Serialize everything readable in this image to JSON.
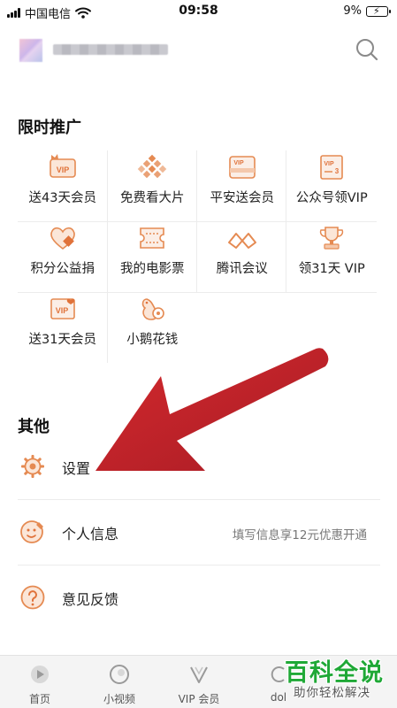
{
  "status_bar": {
    "carrier": "中国电信",
    "time": "09:58",
    "battery": "9%"
  },
  "header": {
    "username": "",
    "search_icon": "search-icon"
  },
  "promo": {
    "title": "限时推广",
    "items": [
      {
        "label": "送43天会员",
        "icon": "vip-badge-icon"
      },
      {
        "label": "免费看大片",
        "icon": "mosaic-icon"
      },
      {
        "label": "平安送会员",
        "icon": "vip-card-icon"
      },
      {
        "label": "公众号领VIP",
        "icon": "vip-3-icon"
      },
      {
        "label": "积分公益捐",
        "icon": "heart-diamond-icon"
      },
      {
        "label": "我的电影票",
        "icon": "ticket-icon"
      },
      {
        "label": "腾讯会议",
        "icon": "meeting-icon"
      },
      {
        "label": "领31天 VIP",
        "icon": "trophy-icon"
      },
      {
        "label": "送31天会员",
        "icon": "vip-heart-icon"
      },
      {
        "label": "小鹅花钱",
        "icon": "goose-coin-icon"
      }
    ]
  },
  "other": {
    "title": "其他",
    "rows": [
      {
        "label": "设置",
        "icon": "gear-icon",
        "hint": ""
      },
      {
        "label": "个人信息",
        "icon": "profile-wrench-icon",
        "hint": "填写信息享12元优惠开通"
      },
      {
        "label": "意见反馈",
        "icon": "question-icon",
        "hint": ""
      }
    ]
  },
  "bottom_nav": [
    {
      "label": "首页",
      "icon": "home-icon"
    },
    {
      "label": "小视频",
      "icon": "short-video-icon"
    },
    {
      "label": "VIP 会员",
      "icon": "vip-icon"
    },
    {
      "label": "dol",
      "icon": "doki-icon"
    }
  ],
  "watermark": {
    "big": "百科全说",
    "small": "助你轻松解决"
  },
  "colors": {
    "accent": "#e07a3f",
    "icon_orange": "#e58a52",
    "arrow_red": "#c0161c",
    "watermark_green": "#1fa836"
  }
}
